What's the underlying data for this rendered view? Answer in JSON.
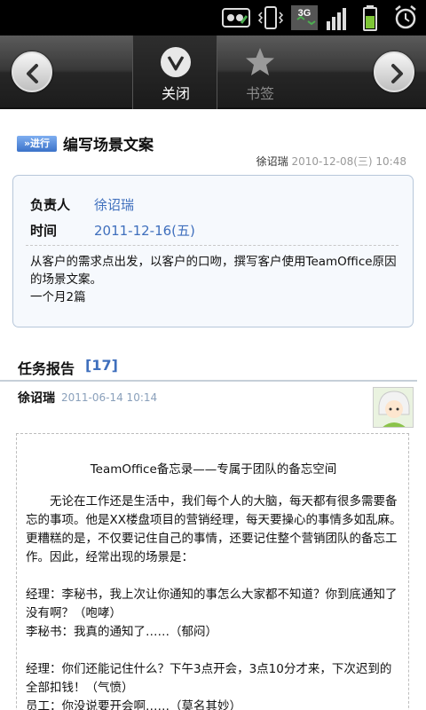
{
  "toolbar": {
    "tabs": [
      {
        "label": "关闭",
        "icon": "close-circle-icon",
        "active": true
      },
      {
        "label": "书签",
        "icon": "star-icon",
        "active": false
      }
    ]
  },
  "task": {
    "status_badge": "进行",
    "title": "编写场景文案",
    "creator": "徐诏瑞",
    "created": "2010-12-08(三) 10:48",
    "owner_label": "负责人",
    "owner": "徐诏瑞",
    "time_label": "时间",
    "time": "2011-12-16(五)",
    "description_1": "从客户的需求点出发，以客户的口吻，撰写客户使用TeamOffice原因的场景文案。",
    "description_2": "一个月2篇"
  },
  "reports": {
    "title": "任务报告",
    "count": "[17]",
    "item": {
      "author": "徐诏瑞",
      "date": "2011-06-14 10:14",
      "heading": "TeamOffice备忘录——专属于团队的备忘空间",
      "paragraphs": [
        "无论在工作还是生活中，我们每个人的大脑，每天都有很多需要备忘的事项。他是XX楼盘项目的营销经理，每天要操心的事情多如乱麻。更糟糕的是，不仅要记住自己的事情，还要记住整个营销团队的备忘工作。因此，经常出现的场景是：",
        "",
        "经理：李秘书，我上次让你通知的事怎么大家都不知道？你到底通知了没有啊？（咆哮）",
        "李秘书：我真的通知了……（郁闷）",
        "",
        "经理：你们还能记住什么？下午3点开会，3点10分才来，下次迟到的全部扣钱！（气愤）",
        "员工：你没说要开会啊……（莫名其妙）"
      ]
    }
  },
  "colors": {
    "accent": "#3f6fbd",
    "card_border": "#b7c7da"
  }
}
